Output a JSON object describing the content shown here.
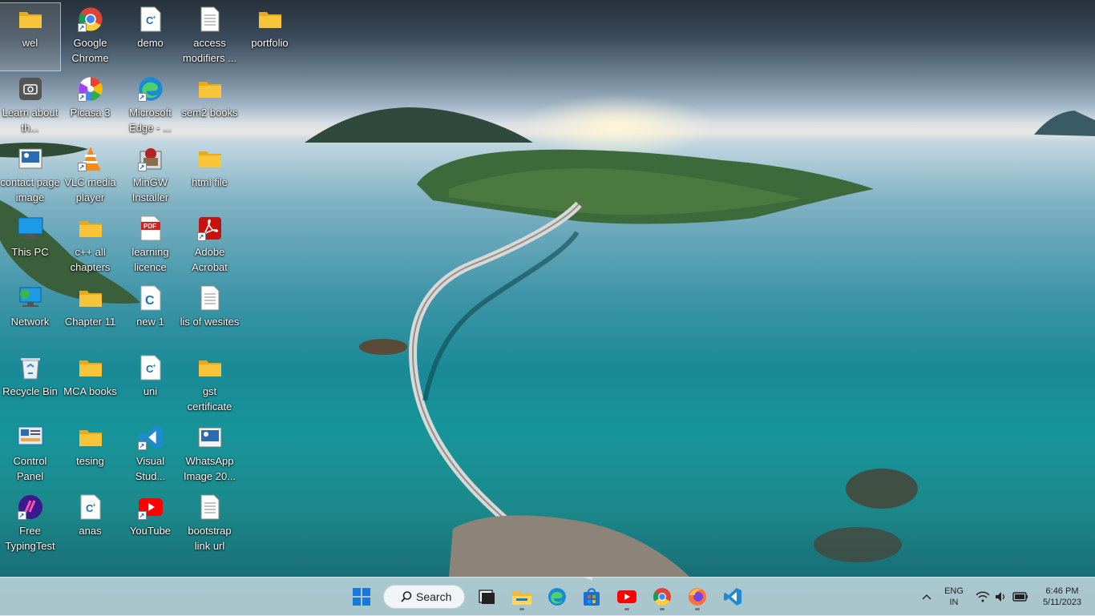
{
  "desktop": {
    "icons": [
      {
        "label": "wel",
        "icon": "folder-icon"
      },
      {
        "label": "Google Chrome",
        "icon": "chrome-icon"
      },
      {
        "label": "demo",
        "icon": "cpp-file-icon"
      },
      {
        "label": "access modifiers ...",
        "icon": "text-file-icon"
      },
      {
        "label": "portfolio",
        "icon": "folder-icon"
      },
      {
        "label": "Learn about th...",
        "icon": "camera-icon"
      },
      {
        "label": "Picasa 3",
        "icon": "picasa-icon"
      },
      {
        "label": "Microsoft Edge - ...",
        "icon": "edge-icon"
      },
      {
        "label": "sem2 books",
        "icon": "folder-icon"
      },
      {
        "label": "contact page image",
        "icon": "image-file-icon"
      },
      {
        "label": "VLC media player",
        "icon": "vlc-icon"
      },
      {
        "label": "MinGW Installer",
        "icon": "mingw-icon"
      },
      {
        "label": "html file",
        "icon": "folder-icon"
      },
      {
        "label": "This PC",
        "icon": "this-pc-icon"
      },
      {
        "label": "c++ all chapters",
        "icon": "folder-icon"
      },
      {
        "label": "learning licence",
        "icon": "pdf-icon"
      },
      {
        "label": "Adobe Acrobat",
        "icon": "acrobat-icon"
      },
      {
        "label": "Network",
        "icon": "network-icon"
      },
      {
        "label": "Chapter 11",
        "icon": "folder-icon"
      },
      {
        "label": "new 1",
        "icon": "c-file-icon"
      },
      {
        "label": "lis of wesites",
        "icon": "text-file-icon"
      },
      {
        "label": "Recycle Bin",
        "icon": "recycle-bin-icon"
      },
      {
        "label": "MCA books",
        "icon": "folder-icon"
      },
      {
        "label": "uni",
        "icon": "cpp-file-icon"
      },
      {
        "label": "gst certificate",
        "icon": "folder-icon"
      },
      {
        "label": "Control Panel",
        "icon": "control-panel-icon"
      },
      {
        "label": "tesing",
        "icon": "folder-icon"
      },
      {
        "label": "Visual Stud...",
        "icon": "vscode-icon"
      },
      {
        "label": "WhatsApp Image 20...",
        "icon": "image-file-icon"
      },
      {
        "label": "Free TypingTest",
        "icon": "typingtest-icon"
      },
      {
        "label": "anas",
        "icon": "cpp-file-icon"
      },
      {
        "label": "YouTube",
        "icon": "youtube-icon"
      },
      {
        "label": "bootstrap link url",
        "icon": "text-file-icon"
      }
    ]
  },
  "taskbar": {
    "search_label": "Search",
    "apps": [
      "start-icon",
      "task-view-icon",
      "file-explorer-icon",
      "edge-icon",
      "store-icon",
      "youtube-icon",
      "chrome-icon",
      "firefox-icon",
      "vscode-icon"
    ],
    "tray": {
      "language": "ENG",
      "region": "IN",
      "time": "6:46 PM",
      "date": "5/11/2023"
    }
  },
  "colors": {
    "folder": "#f8c43a",
    "taskbar_bg": "#d2e2e8"
  }
}
